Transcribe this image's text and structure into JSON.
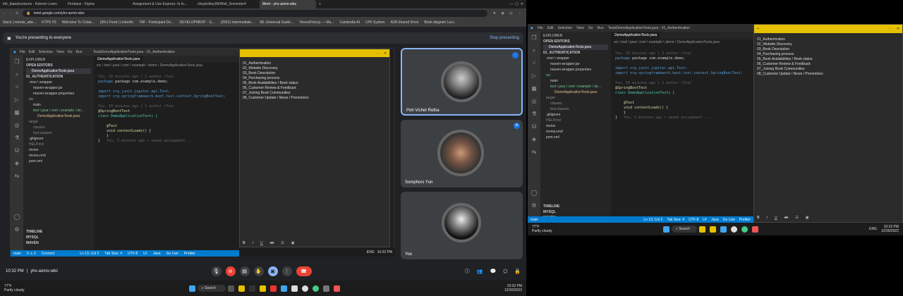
{
  "browser": {
    "tabs": [
      "bih_datastructures - Katonm Learn",
      "Firebase - Figma",
      "Assignment & Use Express .fs to...",
      "cheykolkey99/Web_Semester4",
      "Meet - yhx-aomo-wbz"
    ],
    "url": "meet.google.com/yhx-aomo-wbz",
    "bookmarks": [
      "Slack | remote_atte...",
      "KTPS V5",
      "Welcome To Colab...",
      "(99+) Feed | LinkedIn",
      "TAF - Participant De...",
      "DEVELOPMENT - G...",
      "(2652) Intermediate...",
      "ML Universal Guide...",
      "TensorFlow.js — Ma...",
      "Cambodia AI",
      "LPK System",
      "A2A Shared Drive",
      "Book diagram Luci..."
    ]
  },
  "presenting": {
    "text": "You're presenting to everyone",
    "stop": "Stop presenting"
  },
  "vscode": {
    "menu": [
      "File",
      "Edit",
      "Selection",
      "View",
      "Go",
      "Run"
    ],
    "title": "TestsDemoApplicationTests.java - 01_Authentication",
    "explorer": "EXPLORER",
    "open_editors": "OPEN EDITORS",
    "open_file": "DemoApplicationTests.java",
    "project": "01_AUTHENTICATION",
    "tree": [
      ".mvn \\ wrapper",
      "maven-wrapper.jar",
      "maven-wrapper.properties",
      "src",
      "main",
      "test \\ java \\ com \\ example \\ de...",
      "DemoApplicationTests.java",
      "target",
      "classes",
      "test-classes",
      ".gitignore",
      "HELP.md",
      "mvnw",
      "mvnw.cmd",
      "pom.xml"
    ],
    "breadcrumb": "src \\ test \\ java \\ com \\ example \\ demo \\ DemoApplicationTests.java",
    "blame1": "You, 10 minutes ago | 1 author (You)",
    "blame2": "You, 10 minutes ago | 1 author (You)",
    "code": {
      "pkg": "package com.example.demo;",
      "imp1": "import org.junit.jupiter.api.Test;",
      "imp2": "import org.springframework.boot.test.context.SpringBootTest;",
      "ann": "@SpringBootTest",
      "cls": "class DemoApplicationTests {",
      "test": "@Test",
      "method": "void contextLoads() {",
      "close1": "}",
      "close2": "}",
      "ghost": "You, 5 minutes ago • saved assignment ..."
    },
    "bottom": [
      "TIMELINE",
      "MYSQL",
      "MAVEN"
    ],
    "status": {
      "branch": "main",
      "errors": "0 ⚠ 0",
      "connect": "Connect",
      "pos": "Ln 13, Col 2",
      "tab": "Tab Size: 4",
      "enc": "UTF-8",
      "eol": "LF",
      "lang": "Java",
      "golive": "Go Live",
      "prettier": "Prettier"
    }
  },
  "sticky": {
    "lines": [
      "01_Authentication",
      "02_Website Discovery",
      "03_Book Description",
      "04_Purchasing process",
      "05_Book Availabilities / Book status",
      "06_Customer Review & Feedback",
      "07_Joining Book Communities",
      "08_Customer Update / News / Promotions"
    ],
    "tools": [
      "B",
      "I",
      "U",
      "ab",
      "☰",
      "▣"
    ]
  },
  "meet": {
    "participants": [
      "Poh Vichet Rotha",
      "Somphors Yun",
      "You"
    ],
    "time": "10:32 PM",
    "code": "yhx-aomo-wbz"
  },
  "taskbar": {
    "weather_temp": "77°F",
    "weather_desc": "Partly cloudy",
    "search": "Search",
    "lang": "ENG",
    "time": "10:32 PM",
    "date": "12/30/2022"
  },
  "right_status": {
    "branch": "main",
    "pos": "Ln 13, Col 2",
    "tab": "Tab Size: 4",
    "enc": "UTF-8",
    "eol": "LF",
    "lang": "Java",
    "golive": "Go Live",
    "prettier": "Prettier"
  }
}
